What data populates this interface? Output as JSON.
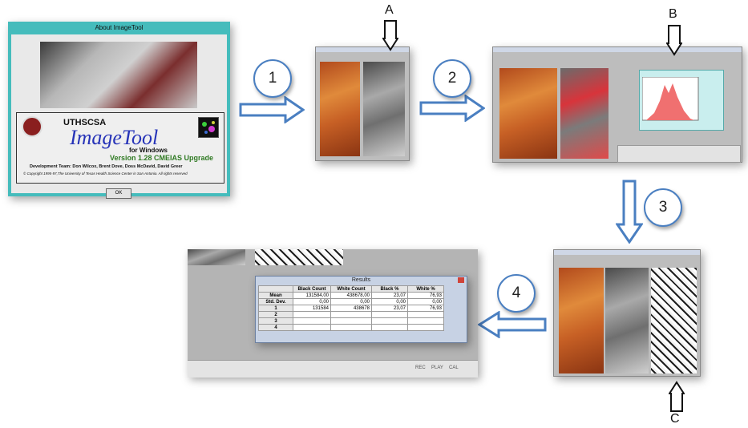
{
  "about": {
    "title": "About ImageTool",
    "org": "UTHSCSA",
    "product": "ImageTool",
    "platform": "for Windows",
    "version": "Version 1.28 CMEIAS Upgrade",
    "dev_team": "Development Team: Don Wilcox, Brent Dove, Doss McDavid, David Greer",
    "copyright": "© Copyright 1995-97,The University of Texas Health Science Center in San Antonio. All rights reserved",
    "ok": "OK"
  },
  "steps": [
    "1",
    "2",
    "3",
    "4"
  ],
  "markers": [
    "A",
    "B",
    "C"
  ],
  "results": {
    "title": "Results",
    "columns": [
      "",
      "Black Count",
      "White Count",
      "Black %",
      "White %"
    ],
    "rows": [
      [
        "Mean",
        "131584,00",
        "438678,00",
        "23,07",
        "76,93"
      ],
      [
        "Std. Dev.",
        "0,00",
        "0,00",
        "0,00",
        "0,00"
      ],
      [
        "1",
        "131584",
        "438678",
        "23,07",
        "76,93"
      ],
      [
        "2",
        "",
        "",
        "",
        ""
      ],
      [
        "3",
        "",
        "",
        "",
        ""
      ],
      [
        "4",
        "",
        "",
        "",
        ""
      ]
    ]
  },
  "status_bar": [
    "REC",
    "PLAY",
    "CAL"
  ],
  "colors": {
    "arrow": "#4a7fc1",
    "about_frame": "#45bcbc"
  }
}
